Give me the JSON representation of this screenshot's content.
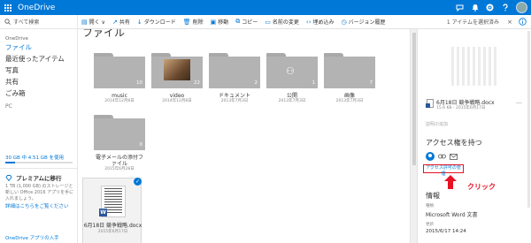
{
  "app": {
    "title": "OneDrive"
  },
  "top_icons": [
    "chat-icon",
    "bell-icon",
    "gear-icon",
    "help-icon"
  ],
  "search": {
    "placeholder": "すべて検索"
  },
  "nav": {
    "section": "OneDrive",
    "items": [
      {
        "label": "ファイル",
        "active": true
      },
      {
        "label": "最近使ったアイテム",
        "active": false
      },
      {
        "label": "写真",
        "active": false
      },
      {
        "label": "共有",
        "active": false
      },
      {
        "label": "ごみ箱",
        "active": false
      }
    ],
    "pc": "PC"
  },
  "storage": {
    "text": "30 GB 中 4.51 GB を使用",
    "used_fraction": 0.15
  },
  "premium": {
    "title": "プレミアムに移行",
    "desc": "1 TB (1,000 GB) のストレージと新しい Office 2016 アプリを手に入れましょう。",
    "link": "詳細はこちらをご覧ください",
    "apps": "OneDrive アプリの入手"
  },
  "toolbar": {
    "items": [
      {
        "icon": "open-icon",
        "label": "開く ∨"
      },
      {
        "icon": "share-icon",
        "label": "共有"
      },
      {
        "icon": "download-icon",
        "label": "ダウンロード"
      },
      {
        "icon": "delete-icon",
        "label": "削除"
      },
      {
        "icon": "move-icon",
        "label": "移動"
      },
      {
        "icon": "copy-icon",
        "label": "コピー"
      },
      {
        "icon": "rename-icon",
        "label": "名前の変更"
      },
      {
        "icon": "embed-icon",
        "label": "埋め込み"
      },
      {
        "icon": "history-icon",
        "label": "バージョン履歴"
      }
    ],
    "selection": "1 アイテムを選択済み",
    "close": "×"
  },
  "main": {
    "heading": "ファイル",
    "folders": [
      {
        "name": "music",
        "date": "2014年12月8日",
        "count": "10",
        "kind": "plain"
      },
      {
        "name": "video",
        "date": "2014年12月8日",
        "count": "22",
        "kind": "photo"
      },
      {
        "name": "ドキュメント",
        "date": "2013年7月3日",
        "count": "2",
        "kind": "plain"
      },
      {
        "name": "公開",
        "date": "2013年7月3日",
        "count": "1",
        "kind": "shared"
      },
      {
        "name": "画像",
        "date": "2013年7月3日",
        "count": "7",
        "kind": "plain"
      },
      {
        "name": "電子メールの添付ファイル",
        "date": "2015年6月28日",
        "count": "0",
        "kind": "plain"
      }
    ],
    "doc": {
      "name": "6月18日 競争戦略.docx",
      "date": "2015年6月17日",
      "badge": "W"
    }
  },
  "panel": {
    "file_name": "6月18日 競争戦略.docx",
    "file_meta": "15.6 KB - 2015年6月17日",
    "more": "…",
    "desc_placeholder": "説明の追加",
    "access_title": "アクセス権を持つ",
    "manage_link": "アクセス許可の管理",
    "click_label": "クリック",
    "info_title": "情報",
    "type_label": "種類",
    "type_value": "Microsoft Word 文書",
    "modified_label": "更新",
    "modified_value": "2015/6/17 14:24"
  }
}
